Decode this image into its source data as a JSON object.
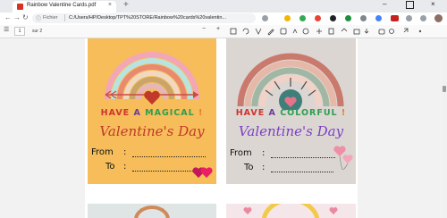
{
  "browser": {
    "tab_title": "Rainbow Valentine Cards.pdf",
    "tab_close": "×",
    "new_tab": "+",
    "address_scheme": "Fichier",
    "address_url": "C:/Users/HP/Desktop/TPT%20STORE/Rainbow%20cards%20valentin...",
    "window_controls": {
      "minimize": "–",
      "maximize": "",
      "close": "×"
    },
    "nav": {
      "back": "←",
      "forward": "→",
      "reload": "↻"
    }
  },
  "pdf_toolbar": {
    "menu": "☰",
    "page_current": "1",
    "page_count": "sur 2",
    "zoom_out": "−",
    "zoom_in": "+"
  },
  "cards": [
    {
      "headline_parts": [
        "HAVE ",
        "A ",
        "MAGICAL",
        " !"
      ],
      "script": "Valentine's Day",
      "from_label": "From",
      "to_label": "To",
      "colon": ":"
    },
    {
      "headline_parts": [
        "HAVE ",
        "A ",
        "COLORFUL",
        " !"
      ],
      "script": "Valentine's Day",
      "from_label": "From",
      "to_label": "To",
      "colon": ":"
    }
  ],
  "colors": {
    "card1_bg": "#f6bd5a",
    "card2_bg": "#dcd6d3",
    "headline_red": "#d0342c",
    "headline_purple": "#6a3d9a",
    "headline_green": "#2e9e4f",
    "headline_orange": "#e67e22",
    "script_red": "#c0392b",
    "script_purple": "#7b3fc4"
  }
}
